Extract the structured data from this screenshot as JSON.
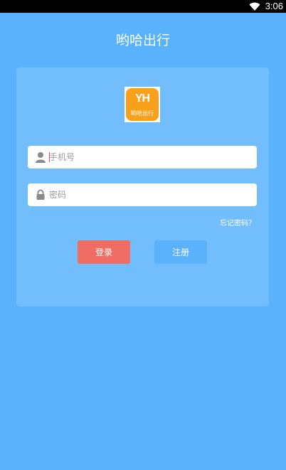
{
  "status_bar": {
    "time": "3:06"
  },
  "header": {
    "title": "哟哈出行"
  },
  "logo": {
    "mark": "YH",
    "text": "哟哈出行"
  },
  "form": {
    "phone_placeholder": "手机号",
    "password_placeholder": "密码",
    "forgot_label": "忘记密码？",
    "login_label": "登录",
    "register_label": "注册"
  },
  "colors": {
    "background": "#59b2fb",
    "card": "#72bdfc",
    "login_button": "#f06d63",
    "register_button": "#5ab2fa",
    "logo": "#f7a21a"
  },
  "icons": {
    "user": "user-icon",
    "lock": "lock-icon",
    "wifi": "wifi-icon"
  }
}
